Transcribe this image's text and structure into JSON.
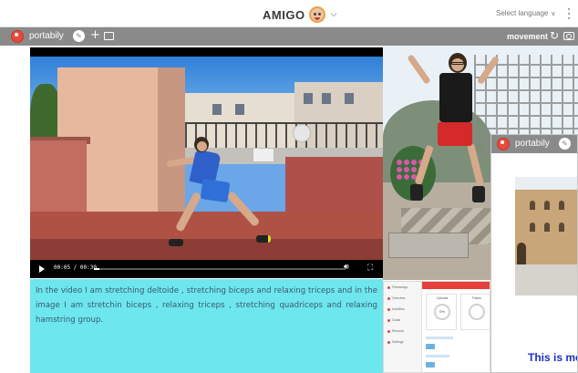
{
  "header": {
    "app_title": "AMIGO",
    "language_label": "Select language",
    "avatar_icon": "avatar-icon",
    "chevron_icon": "chevron-down-icon",
    "menu_icon": "kebab-menu-icon"
  },
  "toolbar": {
    "brand_name": "portabily",
    "logo_icon": "portabily-logo-icon",
    "edit_icon": "edit-pencil-icon",
    "add_label": "+",
    "window_icon": "new-window-icon",
    "project_name": "movement",
    "refresh_icon": "refresh-icon",
    "camera_icon": "camera-icon",
    "background_color": "#8a8a8a"
  },
  "video": {
    "time": "00:05 / 00:30",
    "progress": 0.02,
    "play_icon": "play-icon",
    "volume_icon": "volume-icon",
    "fullscreen_icon": "fullscreen-icon"
  },
  "note": {
    "text": "In the video I am stretching deltoide , stretching biceps and relaxing triceps and in the image I am stretchin biceps , relaxing triceps , stretching quadriceps and relaxing hamstring group.",
    "background_color": "#6de6ee"
  },
  "app_thumbnail": {
    "sidebar_items": [
      "FitnessApp",
      "Overview",
      "Activities",
      "Goals",
      "Records",
      "Settings"
    ],
    "card1_caption": "Calorias",
    "card1_value": "0%",
    "card2_caption": "Pasos",
    "accent_color": "#e5413a"
  },
  "overlay_window": {
    "brand_name": "portabily",
    "caption": "This is me"
  }
}
